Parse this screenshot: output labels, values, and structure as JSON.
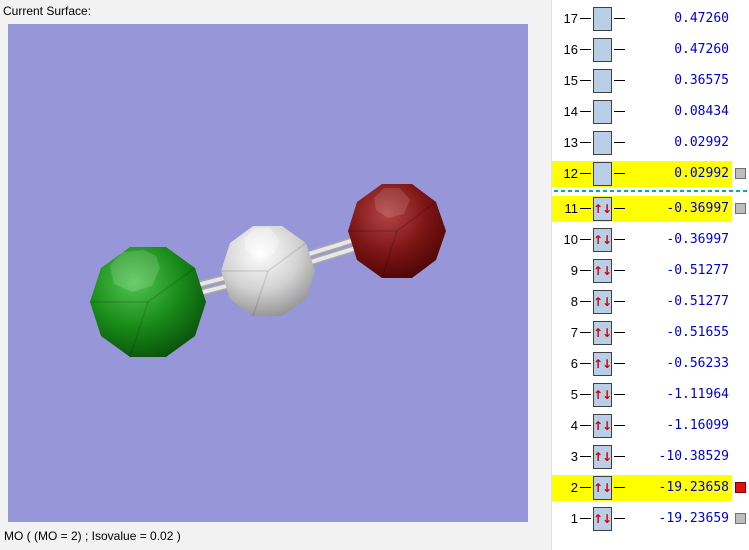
{
  "header": {
    "current_surface_label": "Current Surface:"
  },
  "status": {
    "text": "MO ( (MO = 2) ; Isovalue = 0.02 )"
  },
  "viewport": {
    "background": "#9696d8",
    "atoms": [
      {
        "name": "green-atom",
        "color": "#178a17"
      },
      {
        "name": "gray-atom",
        "color": "#d2d2d2"
      },
      {
        "name": "red-atom",
        "color": "#7c1414"
      }
    ],
    "bond_color": "#d9d9d9"
  },
  "mo_list": {
    "separator_after_index": 12,
    "colors": {
      "energy_text": "#0000cd",
      "highlight": "#ffff00",
      "orbital_box": "#b9cfe8",
      "spin_arrow": "#d00000",
      "separator": "#00b0a0",
      "marker_gray": "#bdbdbd",
      "marker_red": "#e01010"
    },
    "rows": [
      {
        "index": 17,
        "energy": "0.47260",
        "occupied": false,
        "highlighted": false,
        "marker": null
      },
      {
        "index": 16,
        "energy": "0.47260",
        "occupied": false,
        "highlighted": false,
        "marker": null
      },
      {
        "index": 15,
        "energy": "0.36575",
        "occupied": false,
        "highlighted": false,
        "marker": null
      },
      {
        "index": 14,
        "energy": "0.08434",
        "occupied": false,
        "highlighted": false,
        "marker": null
      },
      {
        "index": 13,
        "energy": "0.02992",
        "occupied": false,
        "highlighted": false,
        "marker": null
      },
      {
        "index": 12,
        "energy": "0.02992",
        "occupied": false,
        "highlighted": true,
        "marker": "gray"
      },
      {
        "index": 11,
        "energy": "-0.36997",
        "occupied": true,
        "highlighted": true,
        "marker": "gray"
      },
      {
        "index": 10,
        "energy": "-0.36997",
        "occupied": true,
        "highlighted": false,
        "marker": null
      },
      {
        "index": 9,
        "energy": "-0.51277",
        "occupied": true,
        "highlighted": false,
        "marker": null
      },
      {
        "index": 8,
        "energy": "-0.51277",
        "occupied": true,
        "highlighted": false,
        "marker": null
      },
      {
        "index": 7,
        "energy": "-0.51655",
        "occupied": true,
        "highlighted": false,
        "marker": null
      },
      {
        "index": 6,
        "energy": "-0.56233",
        "occupied": true,
        "highlighted": false,
        "marker": null
      },
      {
        "index": 5,
        "energy": "-1.11964",
        "occupied": true,
        "highlighted": false,
        "marker": null
      },
      {
        "index": 4,
        "energy": "-1.16099",
        "occupied": true,
        "highlighted": false,
        "marker": null
      },
      {
        "index": 3,
        "energy": "-10.38529",
        "occupied": true,
        "highlighted": false,
        "marker": null
      },
      {
        "index": 2,
        "energy": "-19.23658",
        "occupied": true,
        "highlighted": true,
        "marker": "red"
      },
      {
        "index": 1,
        "energy": "-19.23659",
        "occupied": true,
        "highlighted": false,
        "marker": "gray"
      }
    ]
  }
}
